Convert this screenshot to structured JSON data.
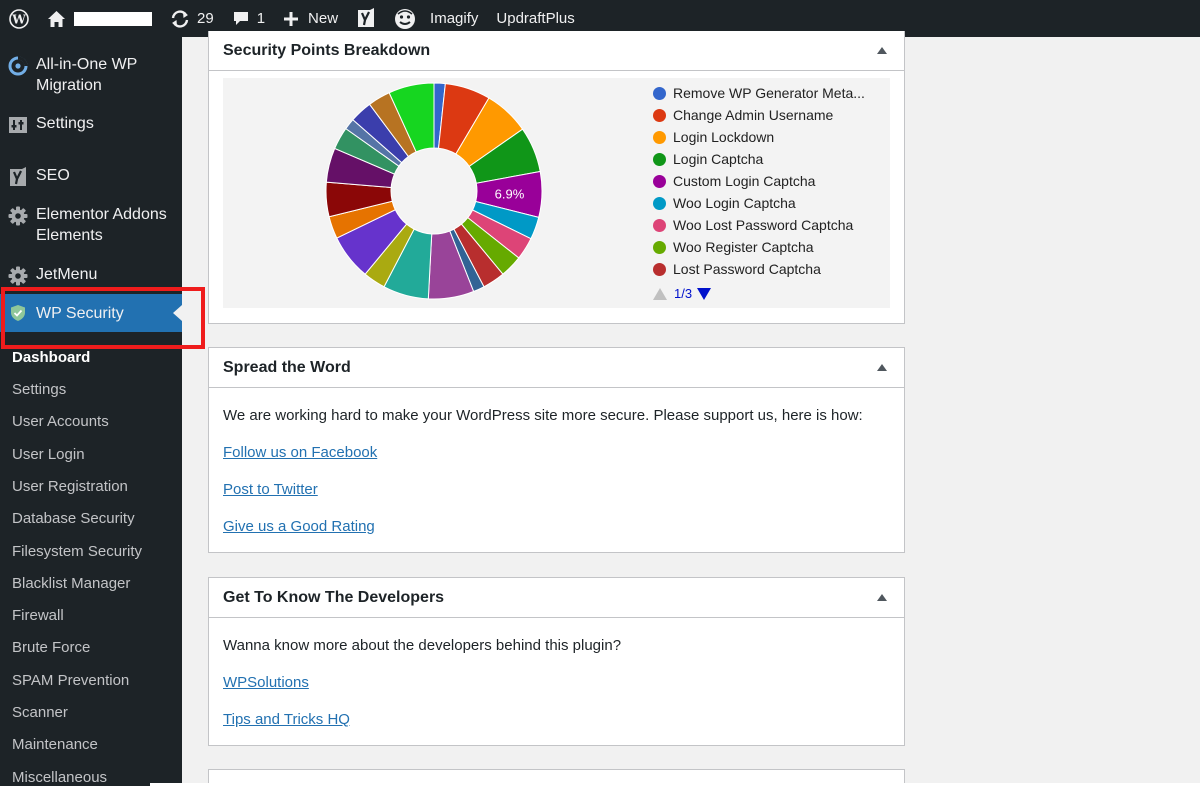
{
  "adminbar": {
    "updates_count": "29",
    "comments_count": "1",
    "new_label": "New",
    "imagify_label": "Imagify",
    "updraftplus_label": "UpdraftPlus"
  },
  "sidebar": {
    "top_items": [
      {
        "label": "All-in-One WP Migration",
        "icon": "migration-icon"
      },
      {
        "label": "Settings",
        "icon": "settings-icon"
      },
      {
        "label": "SEO",
        "icon": "yoast-icon"
      },
      {
        "label": "Elementor Addons Elements",
        "icon": "gear-icon"
      },
      {
        "label": "JetMenu",
        "icon": "gear-icon"
      },
      {
        "label": "WP Security",
        "icon": "shield-icon"
      }
    ],
    "submenu": [
      "Dashboard",
      "Settings",
      "User Accounts",
      "User Login",
      "User Registration",
      "Database Security",
      "Filesystem Security",
      "Blacklist Manager",
      "Firewall",
      "Brute Force",
      "SPAM Prevention",
      "Scanner",
      "Maintenance",
      "Miscellaneous"
    ],
    "accent": "#2271b1",
    "highlight_color": "#ef1c1c"
  },
  "panels": {
    "breakdown": {
      "title": "Security Points Breakdown"
    },
    "spread": {
      "title": "Spread the Word",
      "intro": "We are working hard to make your WordPress site more secure. Please support us, here is how:",
      "links": [
        "Follow us on Facebook",
        "Post to Twitter",
        "Give us a Good Rating"
      ]
    },
    "developers": {
      "title": "Get To Know The Developers",
      "intro": "Wanna know more about the developers behind this plugin?",
      "links": [
        "WPSolutions",
        "Tips and Tricks HQ"
      ]
    }
  },
  "chart_data": {
    "type": "pie",
    "donut": true,
    "legend_position": "right",
    "legend_page": "1/3",
    "slice_label": "6.9%",
    "legend": [
      {
        "name": "Remove WP Generator Meta...",
        "color": "#3366cc"
      },
      {
        "name": "Change Admin Username",
        "color": "#dc3912"
      },
      {
        "name": "Login Lockdown",
        "color": "#ff9900"
      },
      {
        "name": "Login Captcha",
        "color": "#109618"
      },
      {
        "name": "Custom Login Captcha",
        "color": "#990099"
      },
      {
        "name": "Woo Login Captcha",
        "color": "#0099c6"
      },
      {
        "name": "Woo Lost Password Captcha",
        "color": "#dd4477"
      },
      {
        "name": "Woo Register Captcha",
        "color": "#66aa00"
      },
      {
        "name": "Lost Password Captcha",
        "color": "#b82e2e"
      }
    ],
    "slices": [
      {
        "value": 1.7,
        "color": "#3366cc"
      },
      {
        "value": 6.9,
        "color": "#dc3912"
      },
      {
        "value": 6.9,
        "color": "#ff9900"
      },
      {
        "value": 6.9,
        "color": "#109618"
      },
      {
        "value": 6.9,
        "color": "#990099"
      },
      {
        "value": 3.4,
        "color": "#0099c6"
      },
      {
        "value": 3.4,
        "color": "#dd4477"
      },
      {
        "value": 3.4,
        "color": "#66aa00"
      },
      {
        "value": 3.4,
        "color": "#b82e2e"
      },
      {
        "value": 1.7,
        "color": "#316395"
      },
      {
        "value": 6.9,
        "color": "#994499"
      },
      {
        "value": 6.9,
        "color": "#22aa99"
      },
      {
        "value": 3.4,
        "color": "#aaaa11"
      },
      {
        "value": 6.9,
        "color": "#6633cc"
      },
      {
        "value": 3.4,
        "color": "#e67300"
      },
      {
        "value": 5.2,
        "color": "#8b0707"
      },
      {
        "value": 5.2,
        "color": "#651067"
      },
      {
        "value": 3.4,
        "color": "#329262"
      },
      {
        "value": 1.7,
        "color": "#5574a6"
      },
      {
        "value": 3.4,
        "color": "#3b3eac"
      },
      {
        "value": 3.4,
        "color": "#b77322"
      },
      {
        "value": 6.9,
        "color": "#16d620"
      }
    ]
  }
}
